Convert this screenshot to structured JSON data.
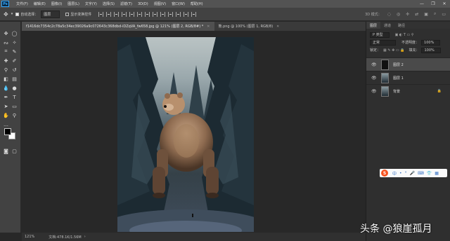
{
  "app": {
    "logo_text": "Ps"
  },
  "menu": [
    "文件(F)",
    "编辑(E)",
    "图像(I)",
    "图层(L)",
    "文字(Y)",
    "选择(S)",
    "滤镜(T)",
    "3D(D)",
    "视图(V)",
    "窗口(W)",
    "帮助(H)"
  ],
  "window_controls": [
    "—",
    "❐",
    "✕"
  ],
  "options": {
    "auto_select_label": "自动选择：",
    "auto_select_value": "图层",
    "transform_controls_label": "显示变换控件",
    "mode_3d": "3D 模式："
  },
  "tabs": [
    {
      "label": "f1416dc7354c2c78a5c34ec39026a9c072643c368dbd-iDZqVA_fw658.jpg @ 121% (图层 2, RGB/8#) *",
      "active": true
    },
    {
      "label": "熊.png @ 100% (图层 1, RGB/8)",
      "active": false
    }
  ],
  "status": {
    "zoom": "121%",
    "doc_info": "文档:478.1K/1.56M"
  },
  "panel": {
    "tabs": [
      "图层",
      "通道",
      "路径"
    ],
    "kind_filter": "P 类型",
    "blend_mode": "正常",
    "opacity_label": "不透明度：",
    "opacity_value": "100%",
    "lock_label": "锁定：",
    "fill_label": "填充：",
    "fill_value": "100%",
    "layers": [
      {
        "name": "图层 2",
        "selected": true
      },
      {
        "name": "图层 1",
        "selected": false
      },
      {
        "name": "背景",
        "selected": false,
        "locked": true
      }
    ]
  },
  "ime": {
    "logo": "S",
    "glyphs": [
      "中",
      "•",
      "°",
      "🎤",
      "⌨",
      "👕",
      "▦"
    ]
  },
  "watermark": "头条 @狼崖孤月"
}
